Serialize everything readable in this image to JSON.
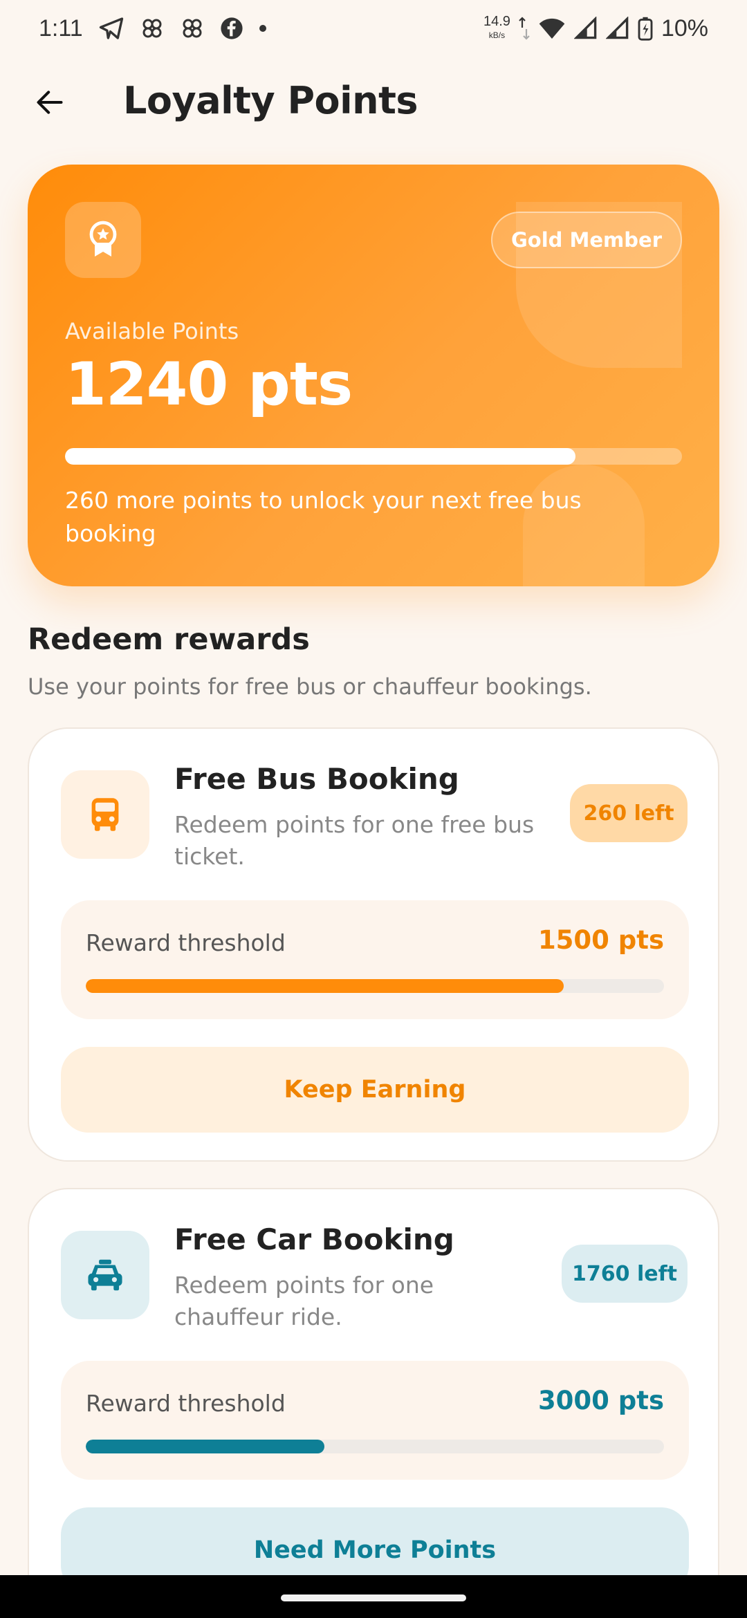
{
  "status_bar": {
    "time": "1:11",
    "net_speed": "14.9",
    "net_unit": "kB/s",
    "battery": "10%",
    "icons": [
      "telegram-icon",
      "pinwheel-icon",
      "pinwheel-icon",
      "facebook-icon",
      "dot-icon",
      "wifi-icon",
      "signal-icon",
      "signal-icon",
      "battery-icon"
    ]
  },
  "app_bar": {
    "title": "Loyalty Points",
    "back_icon": "arrow-left-icon"
  },
  "hero": {
    "medal_icon": "award-medal-icon",
    "member_badge": "Gold Member",
    "available_label": "Available Points",
    "points": "1240 pts",
    "progress_fraction": 0.827,
    "note": "260 more points to unlock your next free bus booking",
    "colors": {
      "from": "#ff8c0a",
      "to": "#ffb048"
    }
  },
  "rewards": {
    "title": "Redeem rewards",
    "subtitle": "Use your points for free bus or chauffeur bookings.",
    "items": [
      {
        "icon": "bus-icon",
        "title": "Free Bus Booking",
        "description": "Redeem points for one free bus ticket.",
        "left_badge": "260 left",
        "threshold_label": "Reward threshold",
        "threshold_value": "1500 pts",
        "progress_fraction": 0.827,
        "action": "Keep Earning",
        "accent": "#ff8c0a"
      },
      {
        "icon": "car-icon",
        "title": "Free Car Booking",
        "description": "Redeem points for one chauffeur ride.",
        "left_badge": "1760 left",
        "threshold_label": "Reward threshold",
        "threshold_value": "3000 pts",
        "progress_fraction": 0.413,
        "action": "Need More Points",
        "accent": "#0e7f96"
      }
    ]
  }
}
